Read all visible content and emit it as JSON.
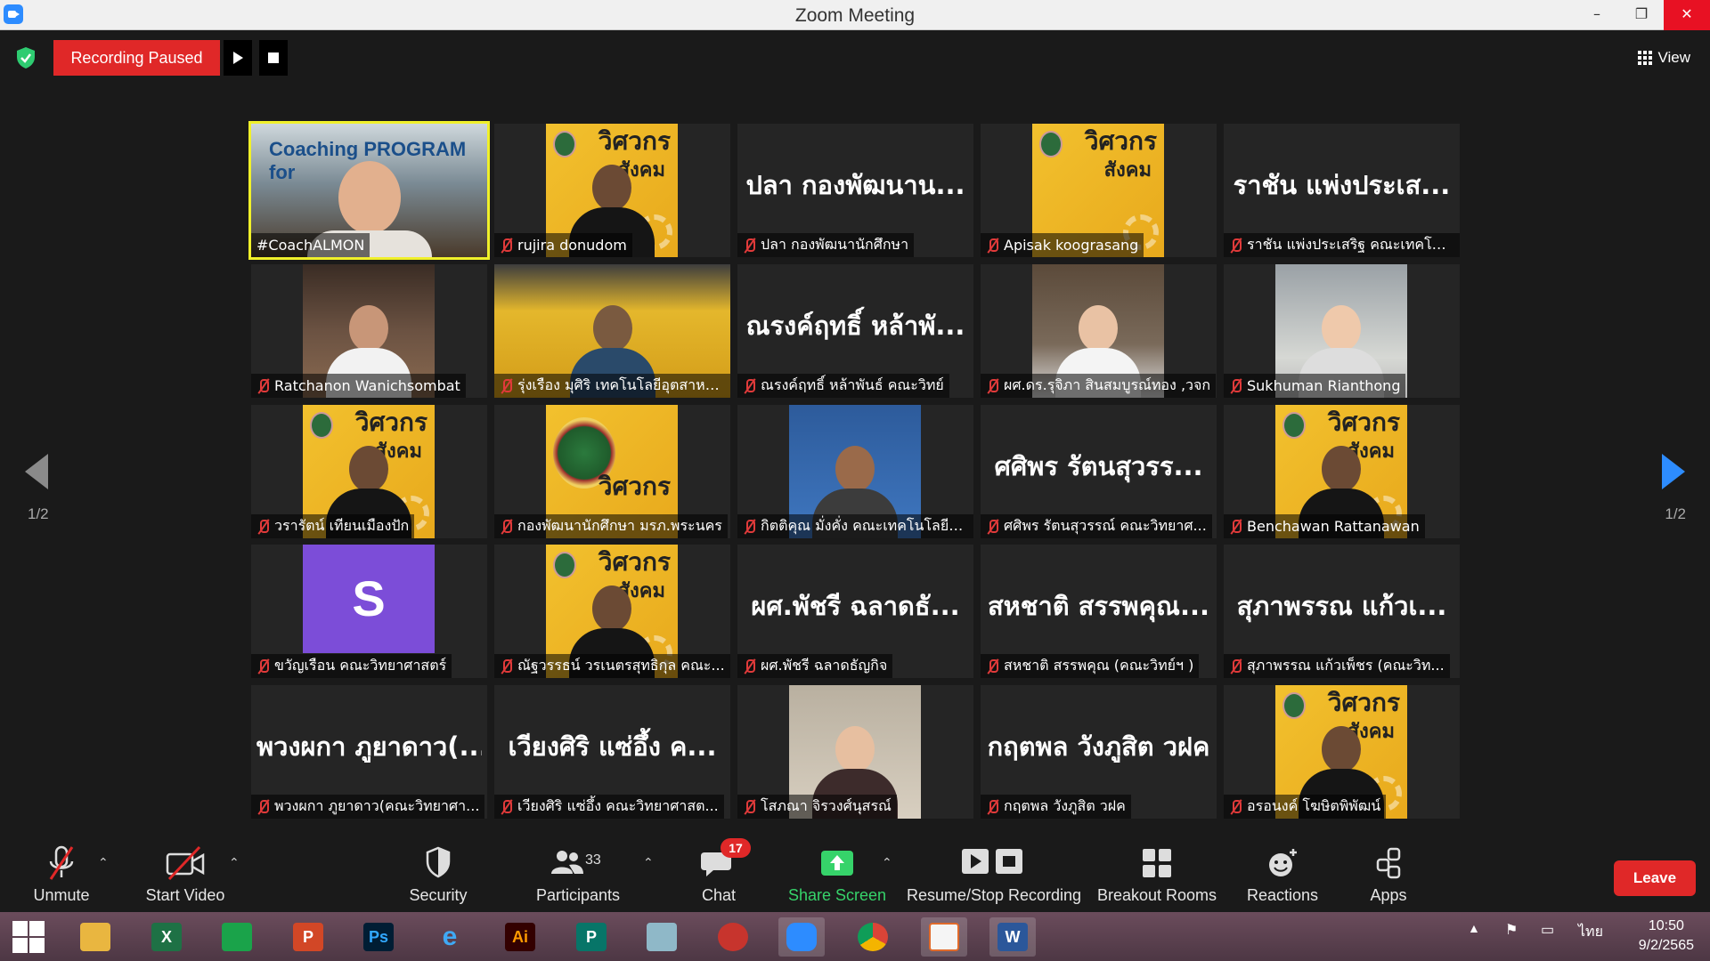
{
  "window": {
    "title": "Zoom Meeting",
    "controls": [
      "–",
      "❐",
      "✕"
    ]
  },
  "top_strip": {
    "recording_status": "Recording Paused",
    "view_label": "View",
    "security_status_color": "#2ecc71"
  },
  "pagination": {
    "prev_page_indicator": "1/2",
    "next_page_indicator": "1/2"
  },
  "participants": [
    {
      "display_name": "#CoachALMON",
      "big_name": "",
      "video": "cam-coach",
      "muted": false,
      "active_speaker": true,
      "banner": "Coaching PROGRAM for"
    },
    {
      "display_name": "rujira donudom",
      "big_name": "",
      "video": "poster-person",
      "muted": true
    },
    {
      "display_name": "ปลา กองพัฒนานักศึกษา",
      "big_name": "ปลา กองพัฒนาน...",
      "video": "none",
      "muted": true
    },
    {
      "display_name": "Apisak koograsang",
      "big_name": "",
      "video": "poster",
      "muted": true
    },
    {
      "display_name": "ราชัน แพ่งประเสริฐ คณะเทคโนโ...",
      "big_name": "ราชัน แพ่งประเส...",
      "video": "none",
      "muted": true
    },
    {
      "display_name": "Ratchanon Wanichsombat",
      "big_name": "",
      "video": "cam-restaurant",
      "muted": true
    },
    {
      "display_name": "รุ่งเรือง มุศิริ เทคโนโลยีอุตสาหกร...",
      "big_name": "",
      "video": "cam-office",
      "muted": true
    },
    {
      "display_name": "ณรงค์ฤทธิ์ หล้าพันธ์ คณะวิทย์",
      "big_name": "ณรงค์ฤทธิ์ หล้าพั...",
      "video": "none",
      "muted": true
    },
    {
      "display_name": "ผศ.ดร.รุจิภา สินสมบูรณ์ทอง ,วจก",
      "big_name": "",
      "video": "cam-cafe",
      "muted": true
    },
    {
      "display_name": "Sukhuman Rianthong",
      "big_name": "",
      "video": "cam-home",
      "muted": true
    },
    {
      "display_name": "วรารัตน์ เทียนเมืองปัก",
      "big_name": "",
      "video": "poster-person",
      "muted": true
    },
    {
      "display_name": "กองพัฒนานักศึกษา มรภ.พระนคร",
      "big_name": "",
      "video": "cam-emblem",
      "muted": true
    },
    {
      "display_name": "กิตติคุณ มั่งคั่ง คณะเทคโนโลยีอุ...",
      "big_name": "",
      "video": "cam-portrait",
      "muted": true
    },
    {
      "display_name": "ศศิพร รัตนสุวรรณ์ คณะวิทยาศ...",
      "big_name": "ศศิพร รัตนสุวรร...",
      "video": "none",
      "muted": true
    },
    {
      "display_name": "Benchawan Rattanawan",
      "big_name": "",
      "video": "poster-person",
      "muted": true
    },
    {
      "display_name": "ขวัญเรือน คณะวิทยาศาสตร์",
      "big_name": "",
      "video": "avatar",
      "avatar_letter": "S",
      "muted": true
    },
    {
      "display_name": "ณัฐวรรธน์ วรเนตรสุทธิกุล คณะ...",
      "big_name": "",
      "video": "poster-person",
      "muted": true
    },
    {
      "display_name": "ผศ.พัชรี ฉลาดธัญกิจ",
      "big_name": "ผศ.พัชรี ฉลาดธั...",
      "video": "none",
      "muted": true
    },
    {
      "display_name": "สหชาติ สรรพคุณ (คณะวิทย์ฯ )",
      "big_name": "สหชาติ สรรพคุณ...",
      "video": "none",
      "muted": true
    },
    {
      "display_name": "สุภาพรรณ แก้วเพ็ชร (คณะวิท...",
      "big_name": "สุภาพรรณ แก้วเ...",
      "video": "none",
      "muted": true
    },
    {
      "display_name": "พวงผกา ภูยาดาว(คณะวิทยาศา...",
      "big_name": "พวงผกา ภูยาดาว(...",
      "video": "none",
      "muted": true
    },
    {
      "display_name": "เวียงศิริ แซ่อึ้ง คณะวิทยาศาสต...",
      "big_name": "เวียงศิริ แซ่อึ้ง ค...",
      "video": "none",
      "muted": true
    },
    {
      "display_name": "โสภณา จิรวงศ์นุสรณ์",
      "big_name": "",
      "video": "cam-selfie",
      "muted": true
    },
    {
      "display_name": "กฤตพล วังภูสิต วฝค",
      "big_name": "กฤตพล วังภูสิต วฝค",
      "video": "none",
      "muted": true
    },
    {
      "display_name": "อรอนงค์ โฆษิตพิพัฒน์",
      "big_name": "",
      "video": "poster-person",
      "muted": true
    }
  ],
  "poster_text": {
    "line1": "วิศวกร",
    "line2": "สังคม"
  },
  "toolbar": {
    "unmute": "Unmute",
    "start_video": "Start Video",
    "security": "Security",
    "participants": "Participants",
    "participant_count": "33",
    "chat": "Chat",
    "chat_unread": "17",
    "share_screen": "Share Screen",
    "recording": "Resume/Stop Recording",
    "breakout_rooms": "Breakout Rooms",
    "reactions": "Reactions",
    "apps": "Apps",
    "leave": "Leave",
    "share_color": "#36d36a",
    "leave_color": "#e02828"
  },
  "taskbar": {
    "apps": [
      {
        "name": "windows-start",
        "label": ""
      },
      {
        "name": "file-explorer",
        "label": ""
      },
      {
        "name": "excel",
        "label": "X"
      },
      {
        "name": "store",
        "label": ""
      },
      {
        "name": "powerpoint",
        "label": "P"
      },
      {
        "name": "photoshop",
        "label": "Ps"
      },
      {
        "name": "internet-explorer",
        "label": "e"
      },
      {
        "name": "illustrator",
        "label": "Ai"
      },
      {
        "name": "publisher",
        "label": "P"
      },
      {
        "name": "notes",
        "label": ""
      },
      {
        "name": "photoscape",
        "label": ""
      },
      {
        "name": "zoom",
        "label": ""
      },
      {
        "name": "chrome",
        "label": ""
      },
      {
        "name": "photos",
        "label": ""
      },
      {
        "name": "word",
        "label": "W"
      }
    ],
    "language": "ไทย",
    "time": "10:50",
    "date": "9/2/2565"
  }
}
